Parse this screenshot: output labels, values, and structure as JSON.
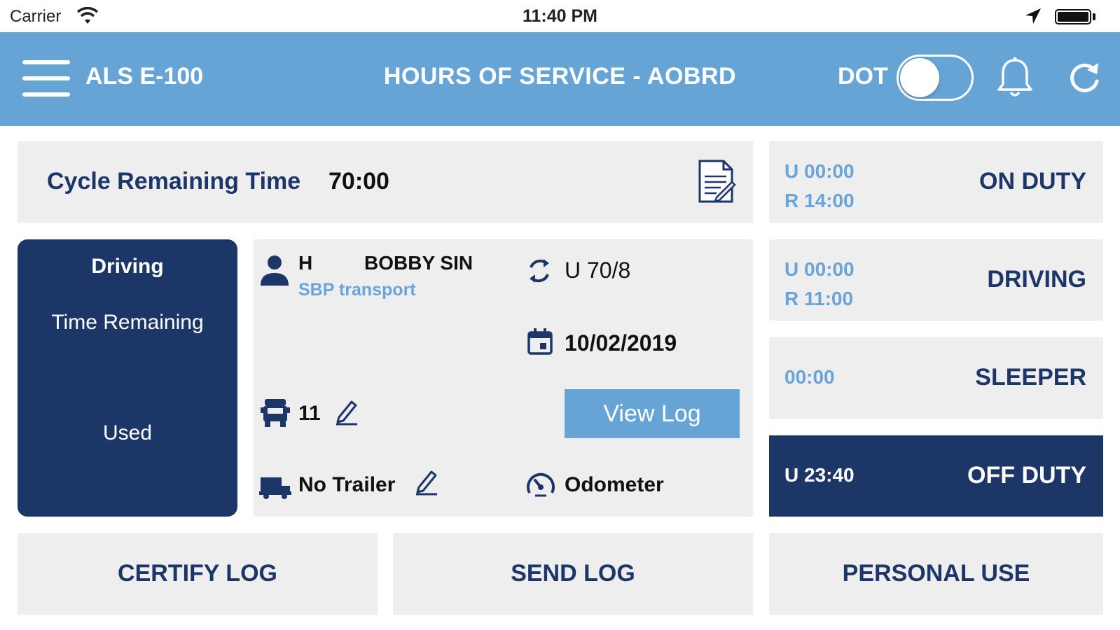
{
  "status_bar": {
    "carrier": "Carrier",
    "time": "11:40 PM"
  },
  "header": {
    "app_title": "ALS E-100",
    "page_title": "HOURS OF SERVICE - AOBRD",
    "dot_label": "DOT",
    "dot_toggle_on": false
  },
  "cycle": {
    "label": "Cycle Remaining Time",
    "value": "70:00"
  },
  "driving_card": {
    "title": "Driving",
    "subtitle": "Time Remaining",
    "used_label": "Used"
  },
  "info": {
    "driver_initial": "H",
    "driver_name": "BOBBY SIN",
    "company": "SBP transport",
    "cycle_rule": "U 70/8",
    "date": "10/02/2019",
    "truck_number": "11",
    "trailer": "No Trailer",
    "odometer_label": "Odometer",
    "view_log_label": "View Log"
  },
  "statuses": [
    {
      "used": "U 00:00",
      "remaining": "R 14:00",
      "label": "ON DUTY",
      "active": false
    },
    {
      "used": "U 00:00",
      "remaining": "R 11:00",
      "label": "DRIVING",
      "active": false
    },
    {
      "used": "00:00",
      "label": "SLEEPER",
      "active": false
    },
    {
      "used": "U 23:40",
      "label": "OFF DUTY",
      "active": true
    }
  ],
  "bottom_buttons": {
    "certify": "CERTIFY LOG",
    "send": "SEND LOG",
    "personal": "PERSONAL USE"
  },
  "colors": {
    "header_blue": "#66a4d6",
    "navy": "#1d3668",
    "panel_gray": "#eeeeee",
    "accent_text": "#6aa5d9"
  }
}
